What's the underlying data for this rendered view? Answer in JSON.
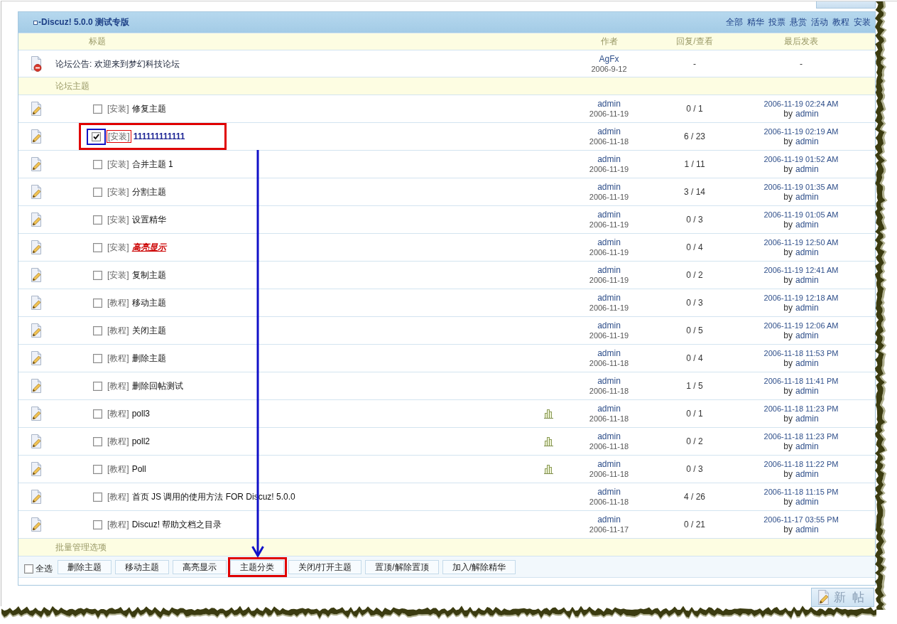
{
  "forum": {
    "title": "-Discuz! 5.0.0 测试专版",
    "filters": [
      "全部",
      "精华",
      "投票",
      "悬赏",
      "活动",
      "教程",
      "安装"
    ]
  },
  "columns": {
    "title": "标题",
    "author": "作者",
    "replies_views": "回复/查看",
    "last_post": "最后发表"
  },
  "announcement": {
    "title": "论坛公告: 欢迎来到梦幻科技论坛",
    "author": "AgFx",
    "date": "2006-9-12",
    "replies_views": "-",
    "last_post": "-"
  },
  "section_label": "论坛主题",
  "threads": [
    {
      "type": "[安装]",
      "title": "修复主题",
      "checked": false,
      "annotated": false,
      "bold": false,
      "italic": false,
      "underline": false,
      "poll": false,
      "author": "admin",
      "date": "2006-11-19",
      "replies_views": "0 / 1",
      "last_post_time": "2006-11-19 02:24 AM",
      "last_post_by": "by",
      "last_poster": "admin"
    },
    {
      "type": "[安装]",
      "title": "111111111111",
      "checked": true,
      "annotated": true,
      "color": "#1c2494",
      "bold": true,
      "italic": false,
      "underline": false,
      "poll": false,
      "author": "admin",
      "date": "2006-11-18",
      "replies_views": "6 / 23",
      "last_post_time": "2006-11-19 02:19 AM",
      "last_post_by": "by",
      "last_poster": "admin"
    },
    {
      "type": "[安装]",
      "title": "合并主题 1",
      "checked": false,
      "annotated": false,
      "bold": false,
      "italic": false,
      "underline": false,
      "poll": false,
      "author": "admin",
      "date": "2006-11-19",
      "replies_views": "1 / 11",
      "last_post_time": "2006-11-19 01:52 AM",
      "last_post_by": "by",
      "last_poster": "admin"
    },
    {
      "type": "[安装]",
      "title": "分割主题",
      "checked": false,
      "annotated": false,
      "bold": false,
      "italic": false,
      "underline": false,
      "poll": false,
      "author": "admin",
      "date": "2006-11-19",
      "replies_views": "3 / 14",
      "last_post_time": "2006-11-19 01:35 AM",
      "last_post_by": "by",
      "last_poster": "admin"
    },
    {
      "type": "[安装]",
      "title": "设置精华",
      "checked": false,
      "annotated": false,
      "bold": false,
      "italic": false,
      "underline": false,
      "poll": false,
      "author": "admin",
      "date": "2006-11-19",
      "replies_views": "0 / 3",
      "last_post_time": "2006-11-19 01:05 AM",
      "last_post_by": "by",
      "last_poster": "admin"
    },
    {
      "type": "[安装]",
      "title": "高亮显示",
      "checked": false,
      "annotated": false,
      "color": "#cc0000",
      "bold": true,
      "italic": true,
      "underline": true,
      "poll": false,
      "author": "admin",
      "date": "2006-11-19",
      "replies_views": "0 / 4",
      "last_post_time": "2006-11-19 12:50 AM",
      "last_post_by": "by",
      "last_poster": "admin"
    },
    {
      "type": "[安装]",
      "title": "复制主题",
      "checked": false,
      "annotated": false,
      "bold": false,
      "italic": false,
      "underline": false,
      "poll": false,
      "author": "admin",
      "date": "2006-11-19",
      "replies_views": "0 / 2",
      "last_post_time": "2006-11-19 12:41 AM",
      "last_post_by": "by",
      "last_poster": "admin"
    },
    {
      "type": "[教程]",
      "title": "移动主题",
      "checked": false,
      "annotated": false,
      "bold": false,
      "italic": false,
      "underline": false,
      "poll": false,
      "author": "admin",
      "date": "2006-11-19",
      "replies_views": "0 / 3",
      "last_post_time": "2006-11-19 12:18 AM",
      "last_post_by": "by",
      "last_poster": "admin"
    },
    {
      "type": "[教程]",
      "title": "关闭主题",
      "checked": false,
      "annotated": false,
      "bold": false,
      "italic": false,
      "underline": false,
      "poll": false,
      "author": "admin",
      "date": "2006-11-19",
      "replies_views": "0 / 5",
      "last_post_time": "2006-11-19 12:06 AM",
      "last_post_by": "by",
      "last_poster": "admin"
    },
    {
      "type": "[教程]",
      "title": "删除主题",
      "checked": false,
      "annotated": false,
      "bold": false,
      "italic": false,
      "underline": false,
      "poll": false,
      "author": "admin",
      "date": "2006-11-18",
      "replies_views": "0 / 4",
      "last_post_time": "2006-11-18 11:53 PM",
      "last_post_by": "by",
      "last_poster": "admin"
    },
    {
      "type": "[教程]",
      "title": "删除回帖测试",
      "checked": false,
      "annotated": false,
      "bold": false,
      "italic": false,
      "underline": false,
      "poll": false,
      "author": "admin",
      "date": "2006-11-18",
      "replies_views": "1 / 5",
      "last_post_time": "2006-11-18 11:41 PM",
      "last_post_by": "by",
      "last_poster": "admin"
    },
    {
      "type": "[教程]",
      "title": "poll3",
      "checked": false,
      "annotated": false,
      "bold": false,
      "italic": false,
      "underline": false,
      "poll": true,
      "author": "admin",
      "date": "2006-11-18",
      "replies_views": "0 / 1",
      "last_post_time": "2006-11-18 11:23 PM",
      "last_post_by": "by",
      "last_poster": "admin"
    },
    {
      "type": "[教程]",
      "title": "poll2",
      "checked": false,
      "annotated": false,
      "bold": false,
      "italic": false,
      "underline": false,
      "poll": true,
      "author": "admin",
      "date": "2006-11-18",
      "replies_views": "0 / 2",
      "last_post_time": "2006-11-18 11:23 PM",
      "last_post_by": "by",
      "last_poster": "admin"
    },
    {
      "type": "[教程]",
      "title": "Poll",
      "checked": false,
      "annotated": false,
      "bold": false,
      "italic": false,
      "underline": false,
      "poll": true,
      "author": "admin",
      "date": "2006-11-18",
      "replies_views": "0 / 3",
      "last_post_time": "2006-11-18 11:22 PM",
      "last_post_by": "by",
      "last_poster": "admin"
    },
    {
      "type": "[教程]",
      "title": "首页 JS 调用的使用方法 FOR Discuz! 5.0.0",
      "checked": false,
      "annotated": false,
      "bold": false,
      "italic": false,
      "underline": false,
      "poll": false,
      "author": "admin",
      "date": "2006-11-18",
      "replies_views": "4 / 26",
      "last_post_time": "2006-11-18 11:15 PM",
      "last_post_by": "by",
      "last_poster": "admin"
    },
    {
      "type": "[教程]",
      "title": "Discuz! 帮助文档之目录",
      "checked": false,
      "annotated": false,
      "bold": false,
      "italic": false,
      "underline": false,
      "poll": false,
      "author": "admin",
      "date": "2006-11-17",
      "replies_views": "0 / 21",
      "last_post_time": "2006-11-17 03:55 PM",
      "last_post_by": "by",
      "last_poster": "admin"
    }
  ],
  "batch": {
    "label": "批量管理选项",
    "select_all": {
      "label": "全选",
      "checked": false
    },
    "buttons": [
      {
        "label": "删除主题",
        "annotated": false
      },
      {
        "label": "移动主题",
        "annotated": false
      },
      {
        "label": "高亮显示",
        "annotated": false
      },
      {
        "label": "主题分类",
        "annotated": true
      },
      {
        "label": "关闭/打开主题",
        "annotated": false
      },
      {
        "label": "置顶/解除置顶",
        "annotated": false
      },
      {
        "label": "加入/解除精华",
        "annotated": false
      }
    ]
  },
  "new_post_button": {
    "label": "新帖"
  }
}
